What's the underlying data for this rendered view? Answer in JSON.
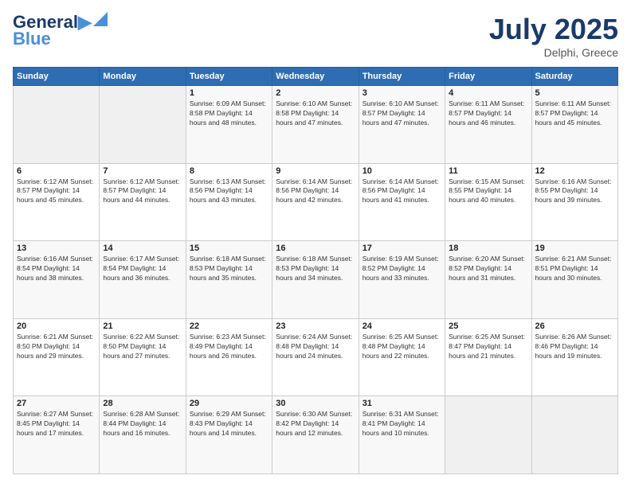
{
  "header": {
    "logo_line1": "General",
    "logo_line2": "Blue",
    "title": "July 2025",
    "subtitle": "Delphi, Greece"
  },
  "days_of_week": [
    "Sunday",
    "Monday",
    "Tuesday",
    "Wednesday",
    "Thursday",
    "Friday",
    "Saturday"
  ],
  "weeks": [
    [
      {
        "day": "",
        "info": ""
      },
      {
        "day": "",
        "info": ""
      },
      {
        "day": "1",
        "info": "Sunrise: 6:09 AM\nSunset: 8:58 PM\nDaylight: 14 hours and 48 minutes."
      },
      {
        "day": "2",
        "info": "Sunrise: 6:10 AM\nSunset: 8:58 PM\nDaylight: 14 hours and 47 minutes."
      },
      {
        "day": "3",
        "info": "Sunrise: 6:10 AM\nSunset: 8:57 PM\nDaylight: 14 hours and 47 minutes."
      },
      {
        "day": "4",
        "info": "Sunrise: 6:11 AM\nSunset: 8:57 PM\nDaylight: 14 hours and 46 minutes."
      },
      {
        "day": "5",
        "info": "Sunrise: 6:11 AM\nSunset: 8:57 PM\nDaylight: 14 hours and 45 minutes."
      }
    ],
    [
      {
        "day": "6",
        "info": "Sunrise: 6:12 AM\nSunset: 8:57 PM\nDaylight: 14 hours and 45 minutes."
      },
      {
        "day": "7",
        "info": "Sunrise: 6:12 AM\nSunset: 8:57 PM\nDaylight: 14 hours and 44 minutes."
      },
      {
        "day": "8",
        "info": "Sunrise: 6:13 AM\nSunset: 8:56 PM\nDaylight: 14 hours and 43 minutes."
      },
      {
        "day": "9",
        "info": "Sunrise: 6:14 AM\nSunset: 8:56 PM\nDaylight: 14 hours and 42 minutes."
      },
      {
        "day": "10",
        "info": "Sunrise: 6:14 AM\nSunset: 8:56 PM\nDaylight: 14 hours and 41 minutes."
      },
      {
        "day": "11",
        "info": "Sunrise: 6:15 AM\nSunset: 8:55 PM\nDaylight: 14 hours and 40 minutes."
      },
      {
        "day": "12",
        "info": "Sunrise: 6:16 AM\nSunset: 8:55 PM\nDaylight: 14 hours and 39 minutes."
      }
    ],
    [
      {
        "day": "13",
        "info": "Sunrise: 6:16 AM\nSunset: 8:54 PM\nDaylight: 14 hours and 38 minutes."
      },
      {
        "day": "14",
        "info": "Sunrise: 6:17 AM\nSunset: 8:54 PM\nDaylight: 14 hours and 36 minutes."
      },
      {
        "day": "15",
        "info": "Sunrise: 6:18 AM\nSunset: 8:53 PM\nDaylight: 14 hours and 35 minutes."
      },
      {
        "day": "16",
        "info": "Sunrise: 6:18 AM\nSunset: 8:53 PM\nDaylight: 14 hours and 34 minutes."
      },
      {
        "day": "17",
        "info": "Sunrise: 6:19 AM\nSunset: 8:52 PM\nDaylight: 14 hours and 33 minutes."
      },
      {
        "day": "18",
        "info": "Sunrise: 6:20 AM\nSunset: 8:52 PM\nDaylight: 14 hours and 31 minutes."
      },
      {
        "day": "19",
        "info": "Sunrise: 6:21 AM\nSunset: 8:51 PM\nDaylight: 14 hours and 30 minutes."
      }
    ],
    [
      {
        "day": "20",
        "info": "Sunrise: 6:21 AM\nSunset: 8:50 PM\nDaylight: 14 hours and 29 minutes."
      },
      {
        "day": "21",
        "info": "Sunrise: 6:22 AM\nSunset: 8:50 PM\nDaylight: 14 hours and 27 minutes."
      },
      {
        "day": "22",
        "info": "Sunrise: 6:23 AM\nSunset: 8:49 PM\nDaylight: 14 hours and 26 minutes."
      },
      {
        "day": "23",
        "info": "Sunrise: 6:24 AM\nSunset: 8:48 PM\nDaylight: 14 hours and 24 minutes."
      },
      {
        "day": "24",
        "info": "Sunrise: 6:25 AM\nSunset: 8:48 PM\nDaylight: 14 hours and 22 minutes."
      },
      {
        "day": "25",
        "info": "Sunrise: 6:25 AM\nSunset: 8:47 PM\nDaylight: 14 hours and 21 minutes."
      },
      {
        "day": "26",
        "info": "Sunrise: 6:26 AM\nSunset: 8:46 PM\nDaylight: 14 hours and 19 minutes."
      }
    ],
    [
      {
        "day": "27",
        "info": "Sunrise: 6:27 AM\nSunset: 8:45 PM\nDaylight: 14 hours and 17 minutes."
      },
      {
        "day": "28",
        "info": "Sunrise: 6:28 AM\nSunset: 8:44 PM\nDaylight: 14 hours and 16 minutes."
      },
      {
        "day": "29",
        "info": "Sunrise: 6:29 AM\nSunset: 8:43 PM\nDaylight: 14 hours and 14 minutes."
      },
      {
        "day": "30",
        "info": "Sunrise: 6:30 AM\nSunset: 8:42 PM\nDaylight: 14 hours and 12 minutes."
      },
      {
        "day": "31",
        "info": "Sunrise: 6:31 AM\nSunset: 8:41 PM\nDaylight: 14 hours and 10 minutes."
      },
      {
        "day": "",
        "info": ""
      },
      {
        "day": "",
        "info": ""
      }
    ]
  ]
}
